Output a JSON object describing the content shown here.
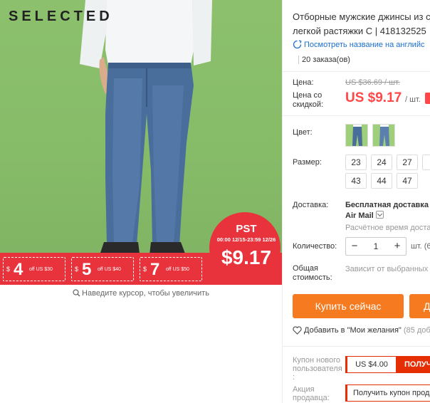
{
  "gallery": {
    "brand": "SELECTED",
    "promo": {
      "coupons": [
        {
          "currency": "$",
          "amount": "4",
          "label": "off US $30"
        },
        {
          "currency": "$",
          "amount": "5",
          "label": "off US $40"
        },
        {
          "currency": "$",
          "amount": "7",
          "label": "off US $50"
        }
      ],
      "code": "PST",
      "dates": "00:00 12/15-23:59 12/26",
      "price": "$9.17"
    },
    "zoom_hint": "Наведите курсор, чтобы увеличить"
  },
  "product": {
    "title_line1": "Отборные мужские джинсы из с",
    "title_line2": "легкой растяжки С | 418132525",
    "translate_link": "Посмотреть название на английс",
    "orders": "20 заказа(ов)"
  },
  "price": {
    "label": "Цена:",
    "old": "US $36.69 / шт.",
    "discount_label_1": "Цена со",
    "discount_label_2": "скидкой:",
    "new": "US $9.17",
    "unit": "/ шт."
  },
  "options": {
    "color_label": "Цвет:",
    "size_label": "Размер:",
    "sizes_row1": [
      "23",
      "24",
      "27"
    ],
    "sizes_row2": [
      "43",
      "44",
      "47"
    ]
  },
  "shipping": {
    "label": "Доставка:",
    "main": "Бесплатная доставка в",
    "method": "Air Mail",
    "time": "Расчётное время доставк"
  },
  "quantity": {
    "label": "Количество:",
    "value": "1",
    "unit": "шт. (6",
    "minus": "−",
    "plus": "+"
  },
  "total": {
    "label_1": "Общая",
    "label_2": "стоимость:",
    "value": "Зависит от выбранных х"
  },
  "actions": {
    "buy": "Купить сейчас",
    "cart": "Д",
    "wishlist": "Добавить в \"Мои желания\"",
    "wishlist_count": "(85 доб"
  },
  "coupons": {
    "new_user_label_1": "Купон нового",
    "new_user_label_2": "пользователя",
    "new_user_label_3": ":",
    "new_user_amount": "US $4.00",
    "new_user_get": "ПОЛУЧ",
    "seller_label_1": "Акция",
    "seller_label_2": "продавца:",
    "seller_get": "Получить купон прода"
  },
  "colors": {
    "accent": "#ff4747",
    "buy_button": "#f67a1f",
    "promo_red": "#e8323c",
    "link": "#1a6fd0",
    "photo_background": "#86bb68"
  }
}
